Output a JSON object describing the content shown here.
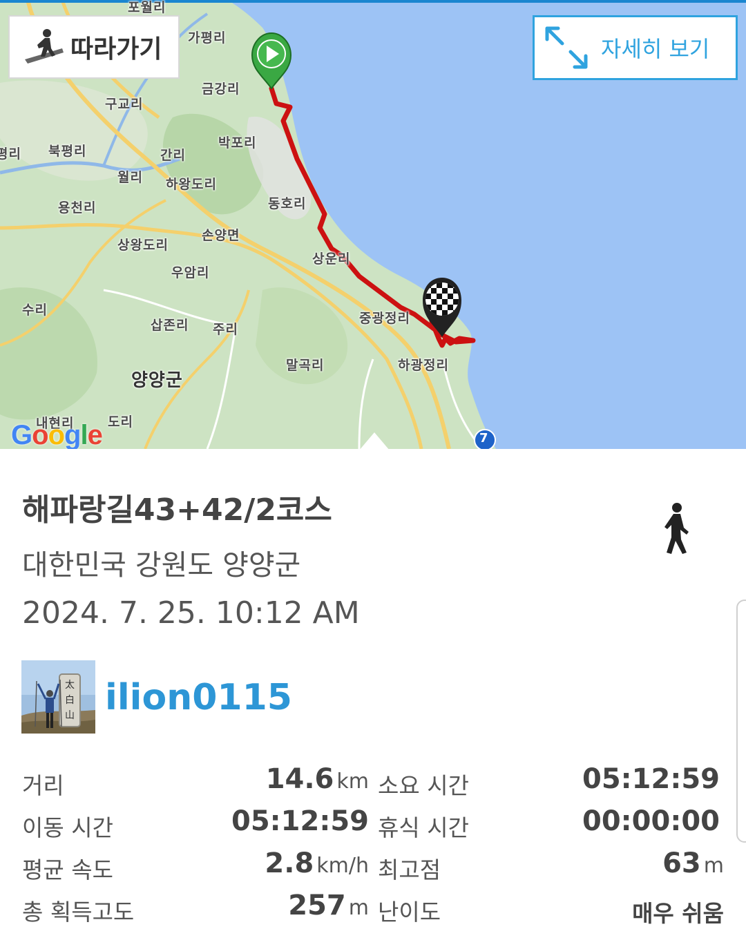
{
  "map": {
    "follow_label": "따라가기",
    "detail_label": "자세히 보기",
    "route_color": "#cc1111",
    "sea_color": "#9dc3f5",
    "land_color": "#cde3c3",
    "google_letters": [
      "G",
      "o",
      "o",
      "g",
      "l",
      "e"
    ],
    "google_colors": [
      "#4285f4",
      "#ea4335",
      "#fbbc05",
      "#4285f4",
      "#34a853",
      "#ea4335"
    ],
    "route_shield": "7",
    "places": [
      "포월리",
      "가평리",
      "금강리",
      "구교리",
      "박포리",
      "북평리",
      "간리",
      "월리",
      "하왕도리",
      "동호리",
      "용천리",
      "손양면",
      "상왕도리",
      "우암리",
      "상운리",
      "수리",
      "중광정리",
      "삽존리",
      "주리",
      "말곡리",
      "하광정리",
      "양양군",
      "내현리",
      "도리",
      "평리"
    ]
  },
  "route": {
    "title": "해파랑길43+42/2코스",
    "location": "대한민국 강원도 양양군",
    "datetime": "2024. 7. 25. 10:12 AM",
    "activity_icon": "walking-person-icon"
  },
  "user": {
    "username": "ilion0115",
    "stone_text": [
      "太",
      "白",
      "山"
    ]
  },
  "stats": {
    "distance": {
      "label": "거리",
      "value": "14.6",
      "unit": "km"
    },
    "total_time": {
      "label": "소요 시간",
      "value": "05:12:59"
    },
    "moving_time": {
      "label": "이동 시간",
      "value": "05:12:59"
    },
    "rest_time": {
      "label": "휴식 시간",
      "value": "00:00:00"
    },
    "avg_speed": {
      "label": "평균 속도",
      "value": "2.8",
      "unit": "km/h"
    },
    "max_elevation": {
      "label": "최고점",
      "value": "63",
      "unit": "m"
    },
    "elevation_gain": {
      "label": "총 획득고도",
      "value": "257",
      "unit": "m"
    },
    "difficulty": {
      "label": "난이도",
      "value": "매우 쉬움"
    }
  }
}
